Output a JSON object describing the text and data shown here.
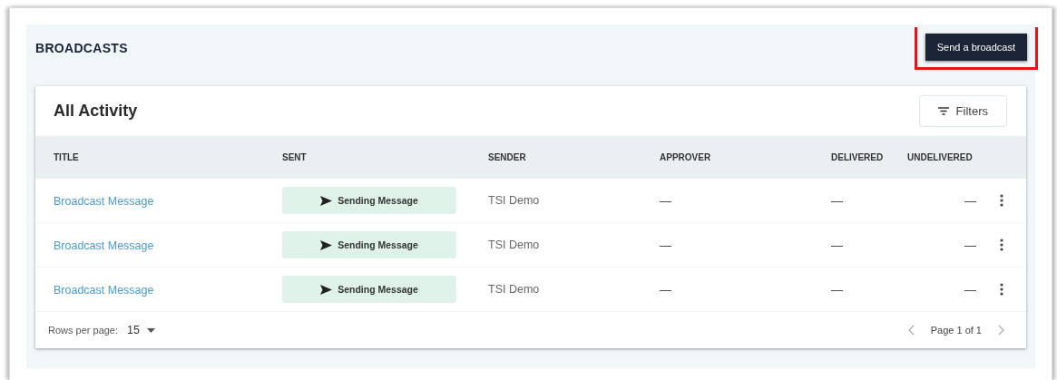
{
  "page": {
    "title": "BROADCASTS",
    "action_button": {
      "label": "Send a broadcast",
      "highlighted": true
    }
  },
  "card": {
    "title": "All Activity",
    "filters_button": "Filters"
  },
  "table": {
    "columns": [
      "TITLE",
      "SENT",
      "SENDER",
      "APPROVER",
      "DELIVERED",
      "UNDELIVERED"
    ],
    "rows": [
      {
        "title": "Broadcast Message",
        "sent": "Sending Message",
        "sender": "TSI Demo",
        "approver": "—",
        "delivered": "—",
        "undelivered": "—"
      },
      {
        "title": "Broadcast Message",
        "sent": "Sending Message",
        "sender": "TSI Demo",
        "approver": "—",
        "delivered": "—",
        "undelivered": "—"
      },
      {
        "title": "Broadcast Message",
        "sent": "Sending Message",
        "sender": "TSI Demo",
        "approver": "—",
        "delivered": "—",
        "undelivered": "—"
      }
    ]
  },
  "pagination": {
    "rows_per_page_label": "Rows per page:",
    "rows_per_page": "15",
    "page_label": "Page 1 of 1"
  }
}
